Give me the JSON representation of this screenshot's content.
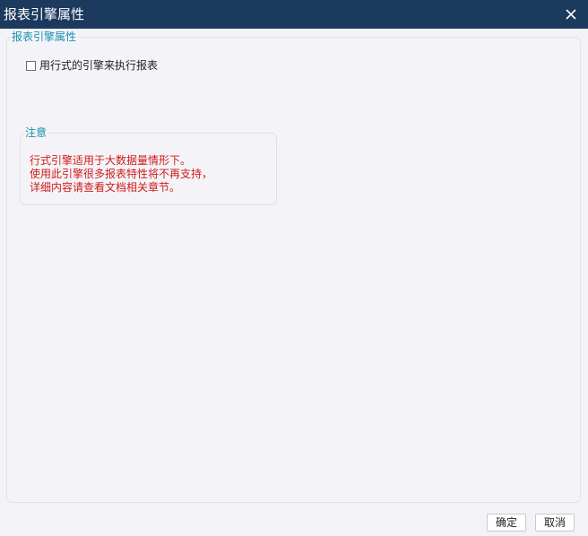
{
  "window": {
    "title": "报表引擎属性"
  },
  "main_group": {
    "title": "报表引擎属性",
    "option": {
      "label": "用行式的引擎来执行报表",
      "checked": false
    }
  },
  "note_group": {
    "title": "注意",
    "lines": [
      "行式引擎适用于大数据量情形下。",
      "使用此引擎很多报表特性将不再支持，",
      "详细内容请查看文档相关章节。"
    ]
  },
  "buttons": {
    "ok": "确定",
    "cancel": "取消"
  },
  "colors": {
    "titlebar": "#1c3a5d",
    "group_title": "#1a8fb0",
    "note_text": "#d11a1a"
  },
  "icons": {
    "close": "close-icon"
  }
}
